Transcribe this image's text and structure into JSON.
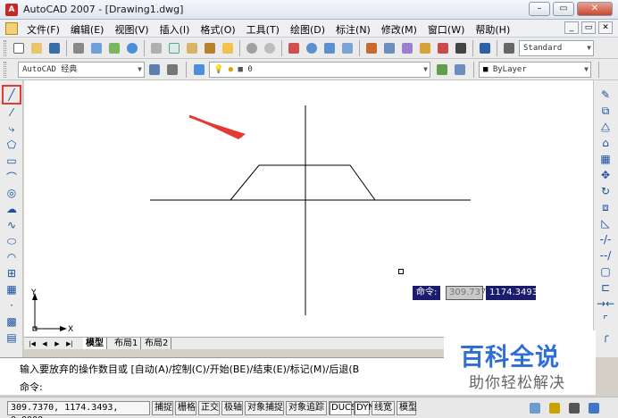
{
  "window": {
    "title": "AutoCAD 2007 - [Drawing1.dwg]"
  },
  "menu": {
    "items": [
      "文件(F)",
      "编辑(E)",
      "视图(V)",
      "插入(I)",
      "格式(O)",
      "工具(T)",
      "绘图(D)",
      "标注(N)",
      "修改(M)",
      "窗口(W)",
      "帮助(H)"
    ]
  },
  "toolbar": {
    "text_style": "Standard",
    "workspace": "AutoCAD 经典",
    "layer": "0",
    "color": "ByLayer"
  },
  "tabs": [
    "模型",
    "布局1",
    "布局2"
  ],
  "command": {
    "history": "输入要放弃的操作数目或 [自动(A)/控制(C)/开始(BE)/结束(E)/标记(M)/后退(B",
    "prompt": "命令:"
  },
  "dynamic_input": {
    "label": "命令:",
    "x": "309.737",
    "y": "1174.3493"
  },
  "ucs": {
    "x": "X",
    "y": "Y"
  },
  "status": {
    "coords": "309.7370, 1174.3493, 0.0000",
    "toggles": [
      {
        "label": "捕捉",
        "on": false
      },
      {
        "label": "栅格",
        "on": false
      },
      {
        "label": "正交",
        "on": false
      },
      {
        "label": "极轴",
        "on": false
      },
      {
        "label": "对象捕捉",
        "on": false
      },
      {
        "label": "对象追踪",
        "on": false
      },
      {
        "label": "DUCS",
        "on": true
      },
      {
        "label": "DYN",
        "on": true
      },
      {
        "label": "线宽",
        "on": false
      },
      {
        "label": "模型",
        "on": false
      }
    ]
  },
  "watermark": {
    "title": "百科全说",
    "subtitle": "助你轻松解决"
  },
  "colors": {
    "accent_arrow": "#e53935",
    "dyn_bg": "#1c1c6e",
    "watermark": "#2f6fd3"
  }
}
